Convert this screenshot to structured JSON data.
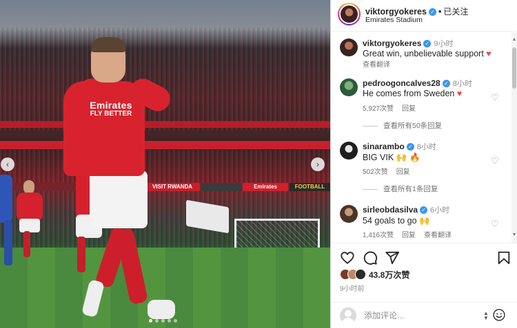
{
  "post": {
    "author": "viktorgyokeres",
    "follow_label": "已关注",
    "separator": "•",
    "location": "Emirates Stadium",
    "nav_prev": "‹",
    "nav_next": "›",
    "photo": {
      "shirt_sponsor_line1": "Emirates",
      "shirt_sponsor_line2": "FLY BETTER",
      "hoardings": [
        "VISIT RWANDA",
        "Emirates",
        "FOOTBALL"
      ]
    }
  },
  "comments": [
    {
      "username": "viktorgyokeres",
      "time": "9小时",
      "text": "Great win, unbelievable support",
      "emoji": "♥",
      "meta": [
        "查看翻译"
      ],
      "avatar_color": "#3a2320"
    },
    {
      "username": "pedroogoncalves28",
      "time": "8小时",
      "text": "He comes from Sweden",
      "emoji": "♥",
      "meta": [
        "5,927次赞",
        "回复"
      ],
      "avatar_color": "#2f5a3a",
      "replies": "查看所有50条回复"
    },
    {
      "username": "sinarambo",
      "time": "8小时",
      "text": "BIG VIK",
      "emoji": "🙌 🔥",
      "meta": [
        "502次赞",
        "回复"
      ],
      "avatar_color": "#1e1e1e",
      "replies": "查看所有1条回复"
    },
    {
      "username": "sirleobdasilva",
      "time": "6小时",
      "text": "54 goals to go",
      "emoji": "🙌",
      "meta": [
        "1,416次赞",
        "回复",
        "查看翻译"
      ],
      "avatar_color": "#4a3428"
    }
  ],
  "actions": {
    "likes": "43.8万次赞",
    "posted": "9小时前"
  },
  "comment_box": {
    "placeholder": "添加评论..."
  },
  "icons": {
    "heart": "heart-icon",
    "comment": "comment-icon",
    "share": "share-icon",
    "save": "bookmark-icon",
    "emoji": "emoji-icon"
  },
  "colors": {
    "verified": "#3897f0",
    "like_red": "#ed4956",
    "arsenal_red": "#d8232e"
  }
}
